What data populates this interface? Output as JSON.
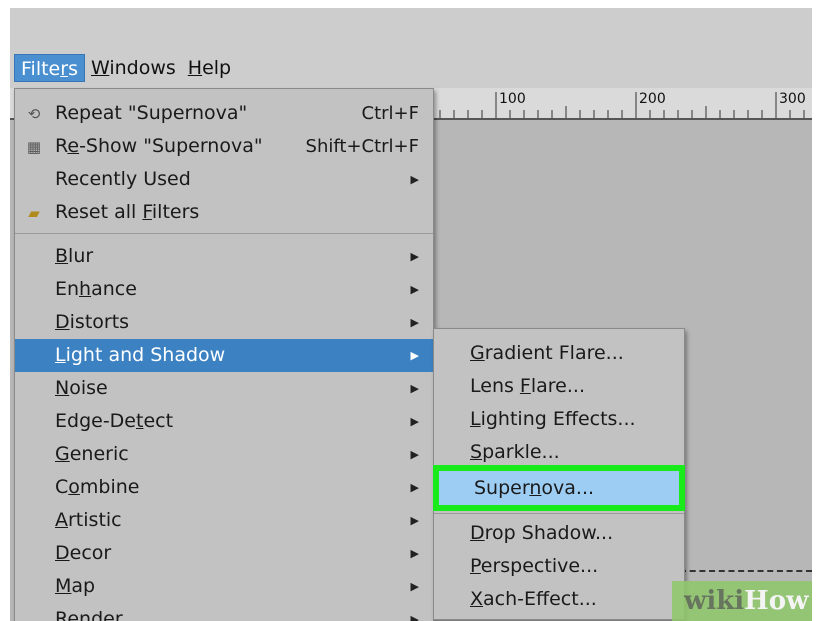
{
  "menubar": {
    "items": [
      {
        "pre": "Filte",
        "ul": "r",
        "post": "s"
      },
      {
        "pre": "",
        "ul": "W",
        "post": "indows"
      },
      {
        "pre": "",
        "ul": "H",
        "post": "elp"
      }
    ]
  },
  "ruler": {
    "labels": [
      "100",
      "200",
      "300"
    ]
  },
  "filters_menu": {
    "items": [
      {
        "icon": "repeat-icon",
        "glyph": "⟲",
        "pre": "Repeat \"Supernova\"",
        "ul": "",
        "post": "",
        "shortcut": "Ctrl+F"
      },
      {
        "icon": "reshow-icon",
        "glyph": "▦",
        "pre": "R",
        "ul": "e",
        "post": "-Show \"Supernova\"",
        "shortcut": "Shift+Ctrl+F"
      },
      {
        "icon": "",
        "glyph": "",
        "pre": "Recently Used",
        "ul": "",
        "post": "",
        "submenu": true
      },
      {
        "icon": "reset-icon",
        "glyph": "▪",
        "pre": "Reset all ",
        "ul": "F",
        "post": "ilters"
      },
      {
        "pre": "",
        "ul": "B",
        "post": "lur",
        "submenu": true
      },
      {
        "pre": "En",
        "ul": "h",
        "post": "ance",
        "submenu": true
      },
      {
        "pre": "",
        "ul": "D",
        "post": "istorts",
        "submenu": true
      },
      {
        "pre": "",
        "ul": "L",
        "post": "ight and Shadow",
        "submenu": true,
        "highlight": true
      },
      {
        "pre": "",
        "ul": "N",
        "post": "oise",
        "submenu": true
      },
      {
        "pre": "Edge-De",
        "ul": "t",
        "post": "ect",
        "submenu": true
      },
      {
        "pre": "",
        "ul": "G",
        "post": "eneric",
        "submenu": true
      },
      {
        "pre": "C",
        "ul": "o",
        "post": "mbine",
        "submenu": true
      },
      {
        "pre": "",
        "ul": "A",
        "post": "rtistic",
        "submenu": true
      },
      {
        "pre": "",
        "ul": "D",
        "post": "ecor",
        "submenu": true
      },
      {
        "pre": "",
        "ul": "M",
        "post": "ap",
        "submenu": true
      },
      {
        "pre": "Render",
        "ul": "",
        "post": "",
        "submenu": true
      }
    ]
  },
  "light_shadow_menu": {
    "items": [
      {
        "pre": "",
        "ul": "G",
        "post": "radient Flare..."
      },
      {
        "pre": "Lens ",
        "ul": "F",
        "post": "lare..."
      },
      {
        "pre": "",
        "ul": "L",
        "post": "ighting Effects..."
      },
      {
        "pre": "",
        "ul": "S",
        "post": "parkle..."
      },
      {
        "pre": "Super",
        "ul": "n",
        "post": "ova...",
        "selected": true
      },
      {
        "pre": "",
        "ul": "D",
        "post": "rop Shadow..."
      },
      {
        "pre": "",
        "ul": "P",
        "post": "erspective..."
      },
      {
        "pre": "",
        "ul": "X",
        "post": "ach-Effect..."
      }
    ]
  },
  "watermark": {
    "w1": "wiki",
    "w2": "How"
  },
  "colors": {
    "highlight": "#3c82c3",
    "selected_bg": "#9dcdf3",
    "selected_outline": "#19ea19"
  }
}
